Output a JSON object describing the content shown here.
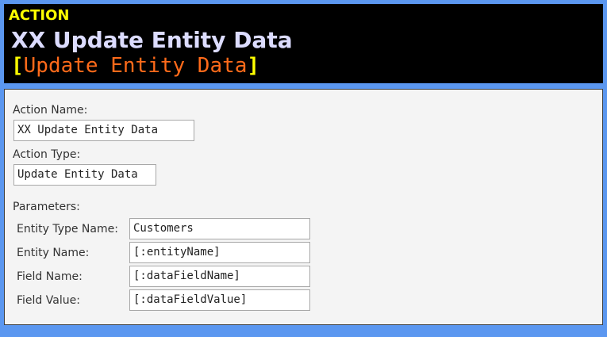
{
  "header": {
    "kind": "ACTION",
    "title": "XX Update Entity Data",
    "subtitle_open": "[",
    "subtitle": "Update Entity Data",
    "subtitle_close": "]"
  },
  "form": {
    "action_name_label": "Action Name:",
    "action_name_value": "XX Update Entity Data",
    "action_type_label": "Action Type:",
    "action_type_value": "Update Entity Data",
    "parameters_label": "Parameters:",
    "parameters": [
      {
        "label": "Entity Type Name:",
        "value": "Customers"
      },
      {
        "label": "Entity Name:",
        "value": "[:entityName]"
      },
      {
        "label": "Field Name:",
        "value": "[:dataFieldName]"
      },
      {
        "label": "Field Value:",
        "value": "[:dataFieldValue]"
      }
    ]
  },
  "colors": {
    "background": "#5b97f0",
    "header_bg": "#000000",
    "kind": "#ffff00",
    "title": "#dcdcff",
    "subtitle": "#ff6a1a",
    "panel_bg": "#f4f4f4"
  }
}
